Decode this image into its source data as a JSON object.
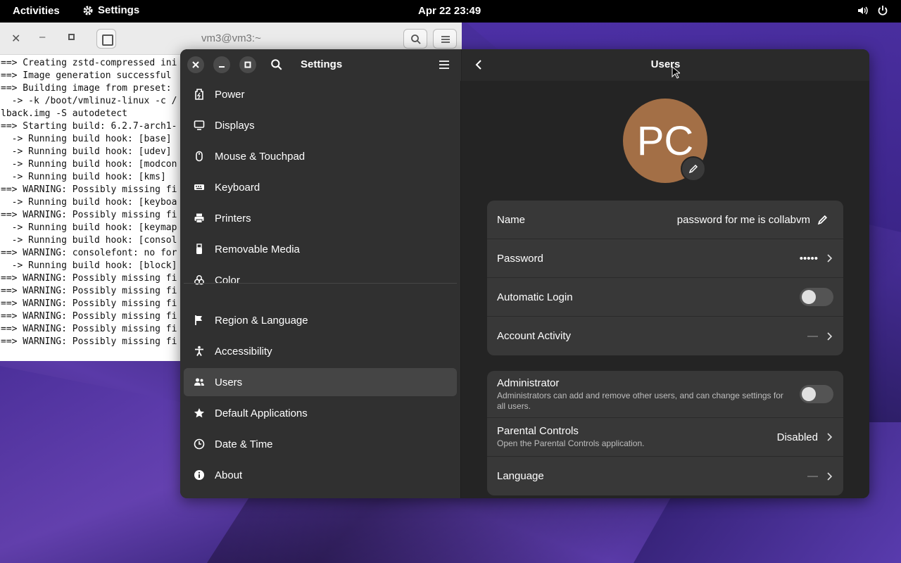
{
  "topbar": {
    "activities": "Activities",
    "app_name": "Settings",
    "clock": "Apr 22  23:49"
  },
  "terminal": {
    "title": "vm3@vm3:~",
    "lines": [
      "==> Creating zstd-compressed ini",
      "==> Image generation successful",
      "==> Building image from preset:",
      "  -> -k /boot/vmlinuz-linux -c /",
      "lback.img -S autodetect",
      "==> Starting build: 6.2.7-arch1-",
      "  -> Running build hook: [base]",
      "  -> Running build hook: [udev]",
      "  -> Running build hook: [modcon",
      "  -> Running build hook: [kms]",
      "==> WARNING: Possibly missing fi",
      "  -> Running build hook: [keyboa",
      "==> WARNING: Possibly missing fi",
      "  -> Running build hook: [keymap",
      "  -> Running build hook: [consol",
      "==> WARNING: consolefont: no for",
      "  -> Running build hook: [block]",
      "==> WARNING: Possibly missing fi",
      "==> WARNING: Possibly missing fi",
      "==> WARNING: Possibly missing fi",
      "==> WARNING: Possibly missing fi",
      "==> WARNING: Possibly missing fi",
      "==> WARNING: Possibly missing fi"
    ]
  },
  "settings": {
    "sidebar_title": "Settings",
    "sidebar_items": [
      {
        "label": "Power",
        "icon": "power-icon"
      },
      {
        "label": "Displays",
        "icon": "display-icon"
      },
      {
        "label": "Mouse & Touchpad",
        "icon": "mouse-icon"
      },
      {
        "label": "Keyboard",
        "icon": "keyboard-icon"
      },
      {
        "label": "Printers",
        "icon": "printer-icon"
      },
      {
        "label": "Removable Media",
        "icon": "usb-icon"
      },
      {
        "label": "Color",
        "icon": "color-icon"
      },
      {
        "label": "Region & Language",
        "icon": "flag-icon"
      },
      {
        "label": "Accessibility",
        "icon": "accessibility-icon"
      },
      {
        "label": "Users",
        "icon": "users-icon"
      },
      {
        "label": "Default Applications",
        "icon": "star-icon"
      },
      {
        "label": "Date & Time",
        "icon": "clock-icon"
      },
      {
        "label": "About",
        "icon": "info-icon"
      }
    ],
    "active_item": "Users",
    "page_title": "Users",
    "avatar_initials": "PC",
    "avatar_color": "#a36f46",
    "account": {
      "name_label": "Name",
      "name_value": "password for me is collabvm",
      "password_label": "Password",
      "password_value": "•••••",
      "auto_login_label": "Automatic Login",
      "auto_login_on": false,
      "activity_label": "Account Activity",
      "activity_value": "—"
    },
    "permissions": {
      "admin_label": "Administrator",
      "admin_desc": "Administrators can add and remove other users, and can change settings for all users.",
      "admin_on": false,
      "parental_label": "Parental Controls",
      "parental_desc": "Open the Parental Controls application.",
      "parental_value": "Disabled",
      "language_label": "Language",
      "language_value": "—"
    }
  }
}
